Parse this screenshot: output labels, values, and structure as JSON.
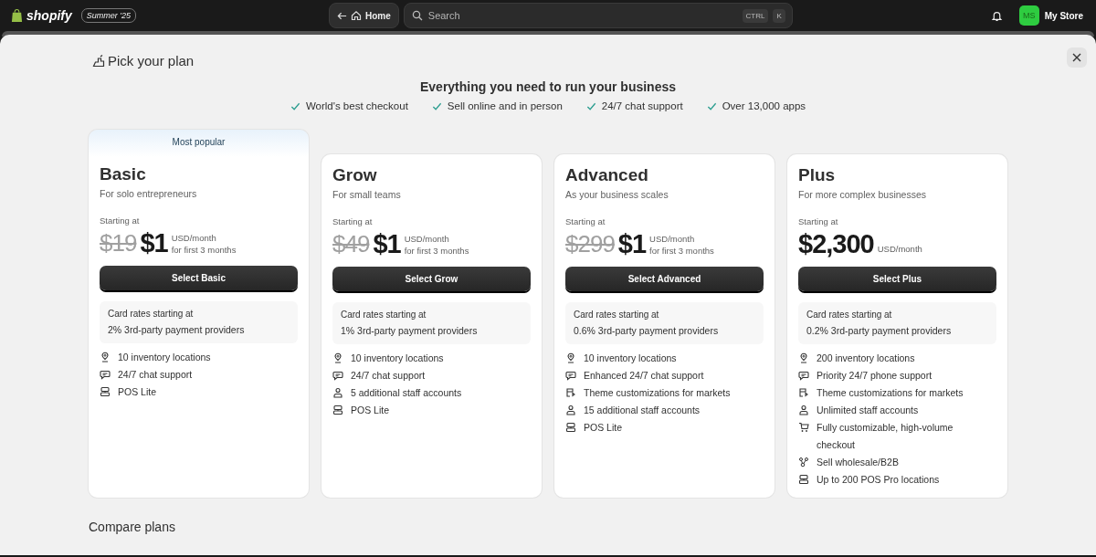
{
  "topbar": {
    "logo": "shopify",
    "edition": "Summer '25",
    "home_button": "Home",
    "search": {
      "placeholder": "Search",
      "keys": [
        "CTRL",
        "K"
      ]
    },
    "avatar": "MS",
    "store": "My Store"
  },
  "modal": {
    "title": "Pick your plan",
    "headline": "Everything you need to run your business",
    "highlights": [
      "World's best checkout",
      "Sell online and in person",
      "24/7 chat support",
      "Over 13,000 apps"
    ],
    "plans": [
      {
        "badge": "Most popular",
        "name": "Basic",
        "tagline": "For solo entrepreneurs",
        "starting": "Starting at",
        "old_price": "$19",
        "price": "$1",
        "unit": "USD/month",
        "note": "for first 3 months",
        "button": "Select Basic",
        "rates_title": "Card rates starting at",
        "rates": "2% 3rd-party payment providers",
        "features": [
          {
            "kind": "location",
            "text": "10 inventory locations"
          },
          {
            "kind": "chat",
            "text": "24/7 chat support"
          },
          {
            "kind": "pos",
            "text": "POS Lite"
          }
        ]
      },
      {
        "name": "Grow",
        "tagline": "For small teams",
        "starting": "Starting at",
        "old_price": "$49",
        "price": "$1",
        "unit": "USD/month",
        "note": "for first 3 months",
        "button": "Select Grow",
        "rates_title": "Card rates starting at",
        "rates": "1% 3rd-party payment providers",
        "features": [
          {
            "kind": "location",
            "text": "10 inventory locations"
          },
          {
            "kind": "chat",
            "text": "24/7 chat support"
          },
          {
            "kind": "staff",
            "text": "5 additional staff accounts"
          },
          {
            "kind": "pos",
            "text": "POS Lite"
          }
        ]
      },
      {
        "name": "Advanced",
        "tagline": "As your business scales",
        "starting": "Starting at",
        "old_price": "$299",
        "price": "$1",
        "unit": "USD/month",
        "note": "for first 3 months",
        "button": "Select Advanced",
        "rates_title": "Card rates starting at",
        "rates": "0.6% 3rd-party payment providers",
        "features": [
          {
            "kind": "location",
            "text": "10 inventory locations"
          },
          {
            "kind": "chat",
            "text": "Enhanced 24/7 chat support"
          },
          {
            "kind": "theme",
            "text": "Theme customizations for markets"
          },
          {
            "kind": "staff",
            "text": "15 additional staff accounts"
          },
          {
            "kind": "pos",
            "text": "POS Lite"
          }
        ]
      },
      {
        "name": "Plus",
        "tagline": "For more complex businesses",
        "starting": "Starting at",
        "price": "$2,300",
        "unit": "USD/month",
        "button": "Select Plus",
        "rates_title": "Card rates starting at",
        "rates": "0.2% 3rd-party payment providers",
        "features": [
          {
            "kind": "location",
            "text": "200 inventory locations"
          },
          {
            "kind": "chat",
            "text": "Priority 24/7 phone support"
          },
          {
            "kind": "theme",
            "text": "Theme customizations for markets"
          },
          {
            "kind": "staff",
            "text": "Unlimited staff accounts"
          },
          {
            "kind": "cart",
            "text": "Fully customizable, high-volume checkout"
          },
          {
            "kind": "wholesale",
            "text": "Sell wholesale/B2B"
          },
          {
            "kind": "pos",
            "text": "Up to 200 POS Pro locations"
          }
        ]
      }
    ],
    "compare_title": "Compare plans"
  }
}
